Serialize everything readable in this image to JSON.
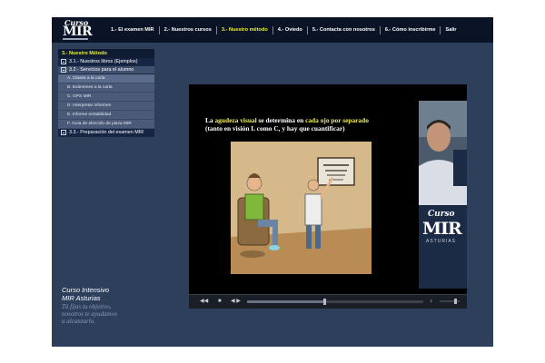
{
  "header": {
    "logo": {
      "top": "Curso",
      "main": "MIR"
    },
    "nav": [
      {
        "label": "1.- El examen MIR",
        "active": false
      },
      {
        "label": "2.- Nuestros cursos",
        "active": false
      },
      {
        "label": "3.- Nuestro método",
        "active": true
      },
      {
        "label": "4.- Oviedo",
        "active": false
      },
      {
        "label": "5.- Contacta con nosotros",
        "active": false
      },
      {
        "label": "6.- Cómo inscribirme",
        "active": false
      },
      {
        "label": "Salir",
        "active": false
      }
    ]
  },
  "sidebar": {
    "title": "3.- Nuestro Método",
    "sections": {
      "libros": "3.1.- Nuestros libros (Ejemplos)",
      "servicios": "3.2.- Servicios para el alumno",
      "preparacion": "3.3.- Preparación del examen MIR"
    },
    "subitems": [
      "A. Clases a la carta",
      "B. Exámenes a la carta",
      "C. GPS MIR",
      "D. Interpretar informes",
      "E. Informe rentabilidad",
      "F. Guía de elección de plaza MIR"
    ]
  },
  "brand": {
    "line1": "Curso Intensivo",
    "line2": "MIR Asturias",
    "tag1": "Tú fijas tu objetivo,",
    "tag2": "nosotros te ayudamos",
    "tag3": "a alcanzarlo."
  },
  "video": {
    "slide": {
      "t1": "La ",
      "t2": "agudeza visual",
      "t3": " se determina en ",
      "t4": "cada ojo por separado",
      "t5": "(tanto en visión L como C, y hay que cuantificar)"
    },
    "inset": {
      "top": "Curso",
      "main": "MIR",
      "bottom": "ASTURIAS"
    },
    "progress": 0.44,
    "volume": 0.75
  },
  "colors": {
    "page_bg": "#2d3f5b",
    "header_bg": "#0b1326",
    "active_nav": "#e7ef3a",
    "highlight": "#f2f05a"
  }
}
